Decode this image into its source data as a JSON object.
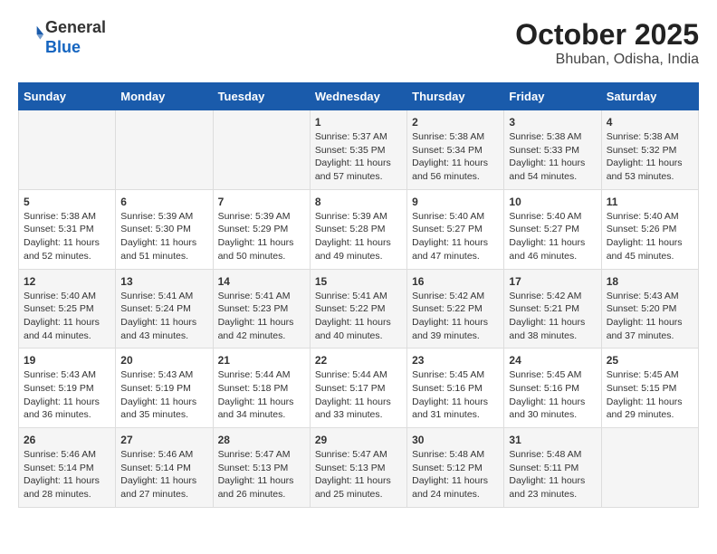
{
  "header": {
    "logo_line1": "General",
    "logo_line2": "Blue",
    "month": "October 2025",
    "location": "Bhuban, Odisha, India"
  },
  "days_of_week": [
    "Sunday",
    "Monday",
    "Tuesday",
    "Wednesday",
    "Thursday",
    "Friday",
    "Saturday"
  ],
  "weeks": [
    [
      {
        "day": "",
        "info": ""
      },
      {
        "day": "",
        "info": ""
      },
      {
        "day": "",
        "info": ""
      },
      {
        "day": "1",
        "info": "Sunrise: 5:37 AM\nSunset: 5:35 PM\nDaylight: 11 hours and 57 minutes."
      },
      {
        "day": "2",
        "info": "Sunrise: 5:38 AM\nSunset: 5:34 PM\nDaylight: 11 hours and 56 minutes."
      },
      {
        "day": "3",
        "info": "Sunrise: 5:38 AM\nSunset: 5:33 PM\nDaylight: 11 hours and 54 minutes."
      },
      {
        "day": "4",
        "info": "Sunrise: 5:38 AM\nSunset: 5:32 PM\nDaylight: 11 hours and 53 minutes."
      }
    ],
    [
      {
        "day": "5",
        "info": "Sunrise: 5:38 AM\nSunset: 5:31 PM\nDaylight: 11 hours and 52 minutes."
      },
      {
        "day": "6",
        "info": "Sunrise: 5:39 AM\nSunset: 5:30 PM\nDaylight: 11 hours and 51 minutes."
      },
      {
        "day": "7",
        "info": "Sunrise: 5:39 AM\nSunset: 5:29 PM\nDaylight: 11 hours and 50 minutes."
      },
      {
        "day": "8",
        "info": "Sunrise: 5:39 AM\nSunset: 5:28 PM\nDaylight: 11 hours and 49 minutes."
      },
      {
        "day": "9",
        "info": "Sunrise: 5:40 AM\nSunset: 5:27 PM\nDaylight: 11 hours and 47 minutes."
      },
      {
        "day": "10",
        "info": "Sunrise: 5:40 AM\nSunset: 5:27 PM\nDaylight: 11 hours and 46 minutes."
      },
      {
        "day": "11",
        "info": "Sunrise: 5:40 AM\nSunset: 5:26 PM\nDaylight: 11 hours and 45 minutes."
      }
    ],
    [
      {
        "day": "12",
        "info": "Sunrise: 5:40 AM\nSunset: 5:25 PM\nDaylight: 11 hours and 44 minutes."
      },
      {
        "day": "13",
        "info": "Sunrise: 5:41 AM\nSunset: 5:24 PM\nDaylight: 11 hours and 43 minutes."
      },
      {
        "day": "14",
        "info": "Sunrise: 5:41 AM\nSunset: 5:23 PM\nDaylight: 11 hours and 42 minutes."
      },
      {
        "day": "15",
        "info": "Sunrise: 5:41 AM\nSunset: 5:22 PM\nDaylight: 11 hours and 40 minutes."
      },
      {
        "day": "16",
        "info": "Sunrise: 5:42 AM\nSunset: 5:22 PM\nDaylight: 11 hours and 39 minutes."
      },
      {
        "day": "17",
        "info": "Sunrise: 5:42 AM\nSunset: 5:21 PM\nDaylight: 11 hours and 38 minutes."
      },
      {
        "day": "18",
        "info": "Sunrise: 5:43 AM\nSunset: 5:20 PM\nDaylight: 11 hours and 37 minutes."
      }
    ],
    [
      {
        "day": "19",
        "info": "Sunrise: 5:43 AM\nSunset: 5:19 PM\nDaylight: 11 hours and 36 minutes."
      },
      {
        "day": "20",
        "info": "Sunrise: 5:43 AM\nSunset: 5:19 PM\nDaylight: 11 hours and 35 minutes."
      },
      {
        "day": "21",
        "info": "Sunrise: 5:44 AM\nSunset: 5:18 PM\nDaylight: 11 hours and 34 minutes."
      },
      {
        "day": "22",
        "info": "Sunrise: 5:44 AM\nSunset: 5:17 PM\nDaylight: 11 hours and 33 minutes."
      },
      {
        "day": "23",
        "info": "Sunrise: 5:45 AM\nSunset: 5:16 PM\nDaylight: 11 hours and 31 minutes."
      },
      {
        "day": "24",
        "info": "Sunrise: 5:45 AM\nSunset: 5:16 PM\nDaylight: 11 hours and 30 minutes."
      },
      {
        "day": "25",
        "info": "Sunrise: 5:45 AM\nSunset: 5:15 PM\nDaylight: 11 hours and 29 minutes."
      }
    ],
    [
      {
        "day": "26",
        "info": "Sunrise: 5:46 AM\nSunset: 5:14 PM\nDaylight: 11 hours and 28 minutes."
      },
      {
        "day": "27",
        "info": "Sunrise: 5:46 AM\nSunset: 5:14 PM\nDaylight: 11 hours and 27 minutes."
      },
      {
        "day": "28",
        "info": "Sunrise: 5:47 AM\nSunset: 5:13 PM\nDaylight: 11 hours and 26 minutes."
      },
      {
        "day": "29",
        "info": "Sunrise: 5:47 AM\nSunset: 5:13 PM\nDaylight: 11 hours and 25 minutes."
      },
      {
        "day": "30",
        "info": "Sunrise: 5:48 AM\nSunset: 5:12 PM\nDaylight: 11 hours and 24 minutes."
      },
      {
        "day": "31",
        "info": "Sunrise: 5:48 AM\nSunset: 5:11 PM\nDaylight: 11 hours and 23 minutes."
      },
      {
        "day": "",
        "info": ""
      }
    ]
  ]
}
